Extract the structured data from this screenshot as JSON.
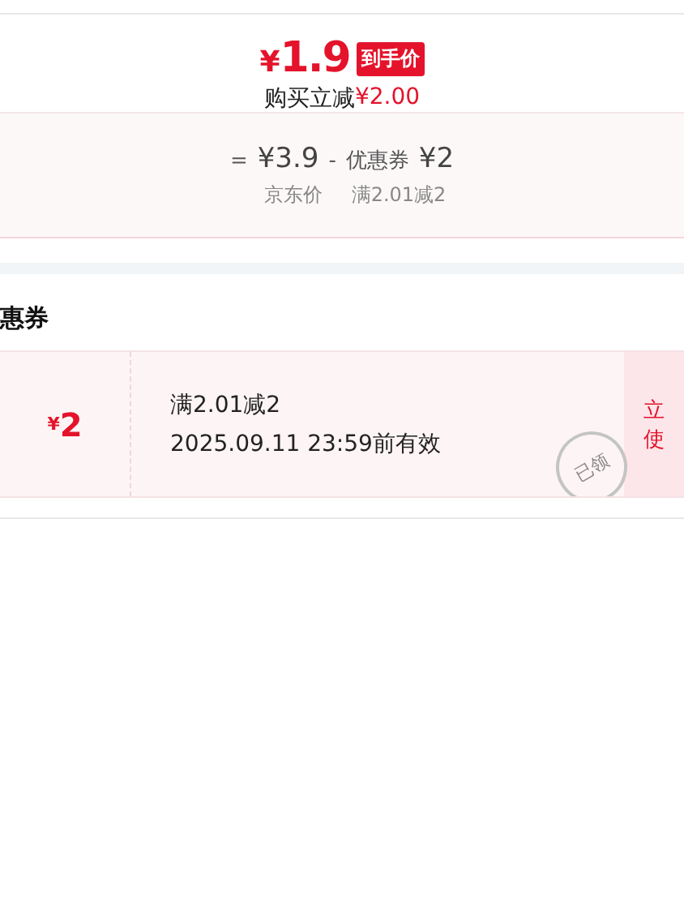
{
  "price_card": {
    "final_symbol": "¥",
    "final_amount": "1.9",
    "badge": "到手价",
    "saving_label": "购买立减",
    "saving_amount": "¥2.00"
  },
  "breakdown": {
    "equals": "=",
    "base_price": "¥3.9",
    "minus": "-",
    "discount_label": "优惠券",
    "discount_amount": "¥2",
    "base_caption": "京东价",
    "discount_caption": "满2.01减2"
  },
  "coupons": {
    "title": "惠券",
    "items": [
      {
        "symbol": "¥",
        "amount": "2",
        "condition": "满2.01减2",
        "expiry": "2025.09.11 23:59前有效",
        "stamp": "已领",
        "action_lines": [
          "立",
          "使"
        ]
      }
    ]
  }
}
